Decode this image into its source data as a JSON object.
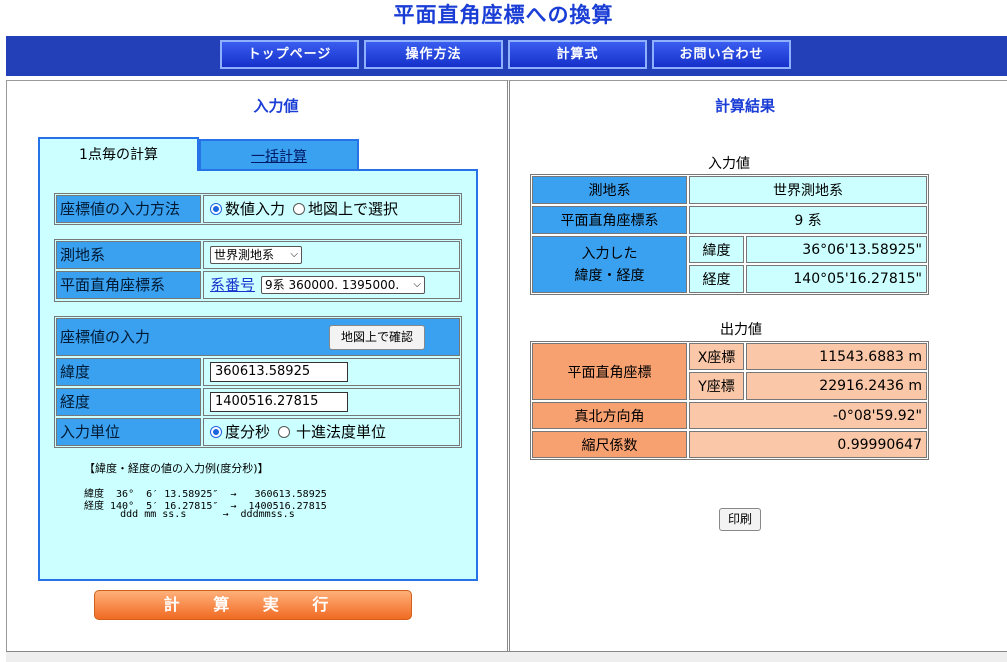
{
  "title": "平面直角座標への換算",
  "nav": {
    "items": [
      "トップページ",
      "操作方法",
      "計算式",
      "お問い合わせ"
    ]
  },
  "left": {
    "section_title": "入力値",
    "tabs": {
      "single": "1点毎の計算",
      "batch": "一括計算"
    },
    "input_method": {
      "label": "座標値の入力方法",
      "opt_numeric": "数値入力",
      "opt_map": "地図上で選択",
      "selected": "numeric"
    },
    "datum": {
      "label": "測地系",
      "value": "世界測地系"
    },
    "plane": {
      "label": "平面直角座標系",
      "link": "系番号",
      "value": "9系 360000. 1395000."
    },
    "coord": {
      "header": "座標値の入力",
      "map_button": "地図上で確認",
      "lat_label": "緯度",
      "lat_value": "360613.58925",
      "lon_label": "経度",
      "lon_value": "1400516.27815",
      "unit_label": "入力単位",
      "unit_dms": "度分秒",
      "unit_decimal": "十進法度単位",
      "unit_selected": "dms"
    },
    "example": {
      "title": "【緯度・経度の値の入力例(度分秒)】",
      "lines": [
        "緯度  36°  6′ 13.58925″  →   360613.58925",
        "経度 140°  5′ 16.27815″  →  1400516.27815",
        "      ddd mm ss.s      →  dddmmss.s"
      ]
    },
    "calc_button": "計 算 実 行"
  },
  "right": {
    "section_title": "計算結果",
    "input": {
      "caption": "入力値",
      "datum_label": "測地系",
      "datum_value": "世界測地系",
      "plane_label": "平面直角座標系",
      "plane_value": "9 系",
      "latlon_label_1": "入力した",
      "latlon_label_2": "緯度・経度",
      "lat_label": "緯度",
      "lat_value": "36°06'13.58925\"",
      "lon_label": "経度",
      "lon_value": "140°05'16.27815\""
    },
    "output": {
      "caption": "出力値",
      "xy_label": "平面直角座標",
      "x_label": "X座標",
      "x_value": "11543.6883 m",
      "y_label": "Y座標",
      "y_value": "22916.2436 m",
      "north_label": "真北方向角",
      "north_value": "-0°08'59.92\"",
      "scale_label": "縮尺係数",
      "scale_value": "0.99990647"
    },
    "print_button": "印刷"
  },
  "colors": {
    "title": "#1a3dd6",
    "nav_bar": "#2440b8",
    "label_blue": "#3aa0f0",
    "panel_cyan": "#ccffff",
    "output_orange": "#f7a070",
    "output_peach": "#fac8a8",
    "calc_orange": "#f06a22"
  }
}
